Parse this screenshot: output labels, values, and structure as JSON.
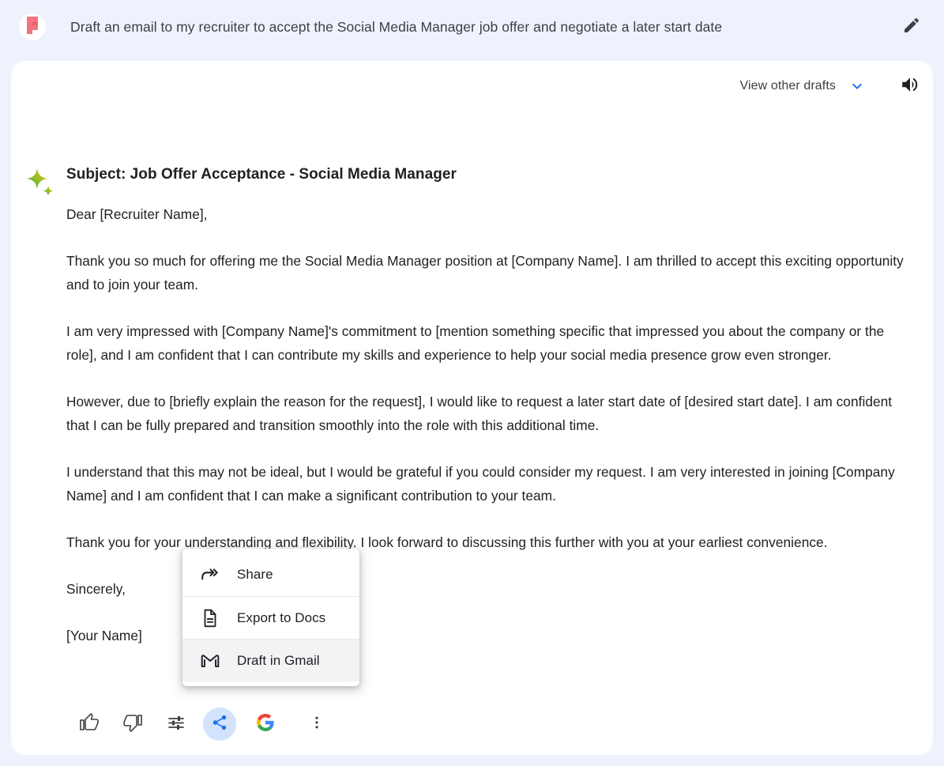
{
  "colors": {
    "page_background": "#eff2fd",
    "card_background": "#ffffff",
    "text_primary": "#202124",
    "accent_blue": "#1a73e8",
    "share_highlight": "#d3e3fd",
    "menu_highlight": "#f1f3f4",
    "avatar_logo": "#f4737f"
  },
  "header": {
    "avatar_icon": "flipboard-f-logo-icon",
    "prompt": "Draft an email to my recruiter to accept the Social Media Manager job offer and negotiate a later start date",
    "edit_icon": "pencil-icon"
  },
  "card": {
    "drafts_label": "View other drafts",
    "drafts_chevron_icon": "chevron-down-icon",
    "speaker_icon": "speaker-icon",
    "response_icon": "sparkle-icon",
    "subject": "Subject: Job Offer Acceptance - Social Media Manager",
    "paragraphs": [
      "Dear [Recruiter Name],",
      "Thank you so much for offering me the Social Media Manager position at [Company Name]. I am thrilled to accept this exciting opportunity and to join your team.",
      "I am very impressed with [Company Name]'s commitment to [mention something specific that impressed you about the company or the role], and I am confident that I can contribute my skills and experience to help your social media presence grow even stronger.",
      "However, due to [briefly explain the reason for the request], I would like to request a later start date of [desired start date]. I am confident that I can be fully prepared and transition smoothly into the role with this additional time.",
      "I understand that this may not be ideal, but I would be grateful if you could consider my request. I am very interested in joining [Company Name] and I am confident that I can make a significant contribution to your team.",
      "Thank you for your understanding and flexibility. I look forward to discussing this further with you at your earliest convenience.",
      "Sincerely,",
      "[Your Name]"
    ]
  },
  "action_bar": {
    "thumb_up_icon": "thumb-up-icon",
    "thumb_down_icon": "thumb-down-icon",
    "tune_icon": "tune-sliders-icon",
    "share_icon": "share-icon",
    "google_icon": "google-g-icon",
    "more_icon": "more-vert-icon"
  },
  "share_menu": {
    "items": [
      {
        "label": "Share",
        "icon": "share-arrow-icon",
        "highlighted": false
      },
      {
        "label": "Export to Docs",
        "icon": "document-icon",
        "highlighted": false
      },
      {
        "label": "Draft in Gmail",
        "icon": "gmail-m-icon",
        "highlighted": true
      }
    ]
  }
}
